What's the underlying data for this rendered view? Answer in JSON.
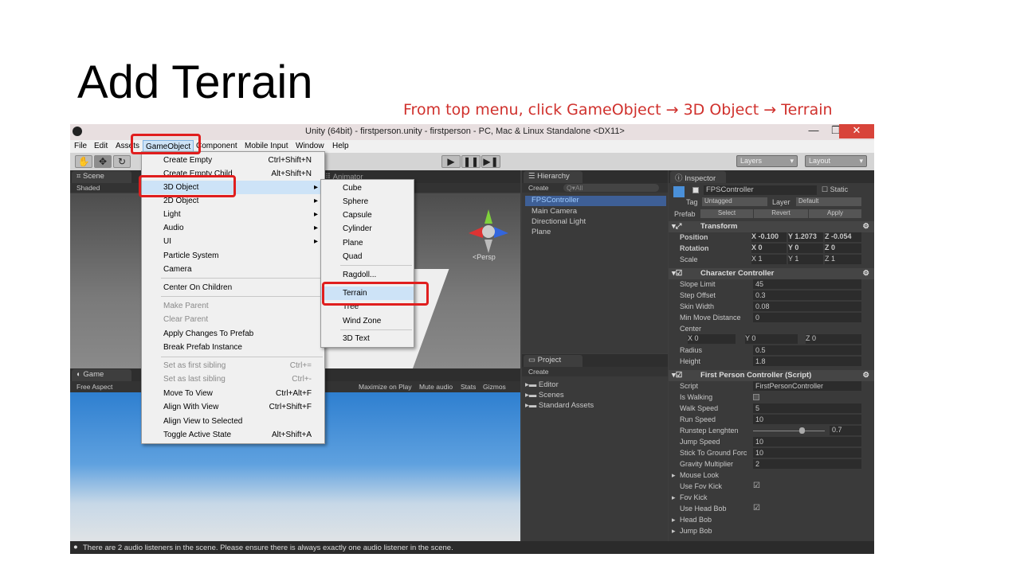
{
  "slide": {
    "title": "Add Terrain",
    "subtitle": "From top menu, click GameObject → 3D Object → Terrain"
  },
  "window": {
    "title": "Unity (64bit) - firstperson.unity - firstperson - PC, Mac & Linux Standalone <DX11>",
    "min": "—",
    "max": "❐",
    "close": "✕"
  },
  "menubar": [
    "File",
    "Edit",
    "Assets",
    "GameObject",
    "Component",
    "Mobile Input",
    "Window",
    "Help"
  ],
  "toolbar": {
    "layers": "Layers",
    "layout": "Layout"
  },
  "scene": {
    "tab": "Scene",
    "shaded": "Shaded",
    "animator": "Animator",
    "persp": "<Persp"
  },
  "game": {
    "tab": "Game",
    "aspect": "Free Aspect",
    "maximize": "Maximize on Play",
    "mute": "Mute audio",
    "stats": "Stats",
    "gizmos": "Gizmos"
  },
  "hierarchy": {
    "tab": "Hierarchy",
    "create": "Create",
    "search": "Q▾All",
    "items": [
      "FPSController",
      "Main Camera",
      "Directional Light",
      "Plane"
    ]
  },
  "project": {
    "tab": "Project",
    "create": "Create",
    "items": [
      "Editor",
      "Scenes",
      "Standard Assets"
    ]
  },
  "gameobject_menu": [
    {
      "label": "Create Empty",
      "shortcut": "Ctrl+Shift+N"
    },
    {
      "label": "Create Empty Child",
      "shortcut": "Alt+Shift+N"
    },
    {
      "label": "3D Object",
      "arrow": "▸"
    },
    {
      "label": "2D Object",
      "arrow": "▸"
    },
    {
      "label": "Light",
      "arrow": "▸"
    },
    {
      "label": "Audio",
      "arrow": "▸"
    },
    {
      "label": "UI",
      "arrow": "▸"
    },
    {
      "label": "Particle System"
    },
    {
      "label": "Camera"
    },
    {
      "label": "Center On Children"
    },
    {
      "label": "Make Parent"
    },
    {
      "label": "Clear Parent"
    },
    {
      "label": "Apply Changes To Prefab"
    },
    {
      "label": "Break Prefab Instance"
    },
    {
      "label": "Set as first sibling",
      "shortcut": "Ctrl+="
    },
    {
      "label": "Set as last sibling",
      "shortcut": "Ctrl+-"
    },
    {
      "label": "Move To View",
      "shortcut": "Ctrl+Alt+F"
    },
    {
      "label": "Align With View",
      "shortcut": "Ctrl+Shift+F"
    },
    {
      "label": "Align View to Selected"
    },
    {
      "label": "Toggle Active State",
      "shortcut": "Alt+Shift+A"
    }
  ],
  "submenu_3d": [
    "Cube",
    "Sphere",
    "Capsule",
    "Cylinder",
    "Plane",
    "Quad",
    "Ragdoll...",
    "Terrain",
    "Tree",
    "Wind Zone",
    "3D Text"
  ],
  "inspector": {
    "tab": "Inspector",
    "name": "FPSController",
    "static": "Static",
    "tag_label": "Tag",
    "tag": "Untagged",
    "layer_label": "Layer",
    "layer": "Default",
    "prefab": "Prefab",
    "select": "Select",
    "revert": "Revert",
    "apply": "Apply",
    "transform": {
      "title": "Transform",
      "position": "Position",
      "rotation": "Rotation",
      "scale": "Scale",
      "px": "X -0.100",
      "py": "Y 1.2073",
      "pz": "Z -0.054",
      "rx": "X 0",
      "ry": "Y 0",
      "rz": "Z 0",
      "sx": "X 1",
      "sy": "Y 1",
      "sz": "Z 1"
    },
    "cc": {
      "title": "Character Controller",
      "rows": [
        [
          "Slope Limit",
          "45"
        ],
        [
          "Step Offset",
          "0.3"
        ],
        [
          "Skin Width",
          "0.08"
        ],
        [
          "Min Move Distance",
          "0"
        ]
      ],
      "center": "Center",
      "cx": "X 0",
      "cy": "Y 0",
      "cz": "Z 0",
      "radius": [
        "Radius",
        "0.5"
      ],
      "height": [
        "Height",
        "1.8"
      ]
    },
    "fpc": {
      "title": "First Person Controller (Script)",
      "script": [
        "Script",
        "FirstPersonController"
      ],
      "rows": [
        [
          "Is Walking",
          ""
        ],
        [
          "Walk Speed",
          "5"
        ],
        [
          "Run Speed",
          "10"
        ],
        [
          "Runstep Lenghten",
          "0.7"
        ],
        [
          "Jump Speed",
          "10"
        ],
        [
          "Stick To Ground Forc",
          "10"
        ],
        [
          "Gravity Multiplier",
          "2"
        ],
        [
          "Mouse Look",
          ""
        ],
        [
          "Use Fov Kick",
          ""
        ],
        [
          "Fov Kick",
          ""
        ],
        [
          "Use Head Bob",
          ""
        ],
        [
          "Head Bob",
          ""
        ],
        [
          "Jump Bob",
          ""
        ]
      ]
    }
  },
  "status": "There are 2 audio listeners in the scene. Please ensure there is always exactly one audio listener in the scene."
}
